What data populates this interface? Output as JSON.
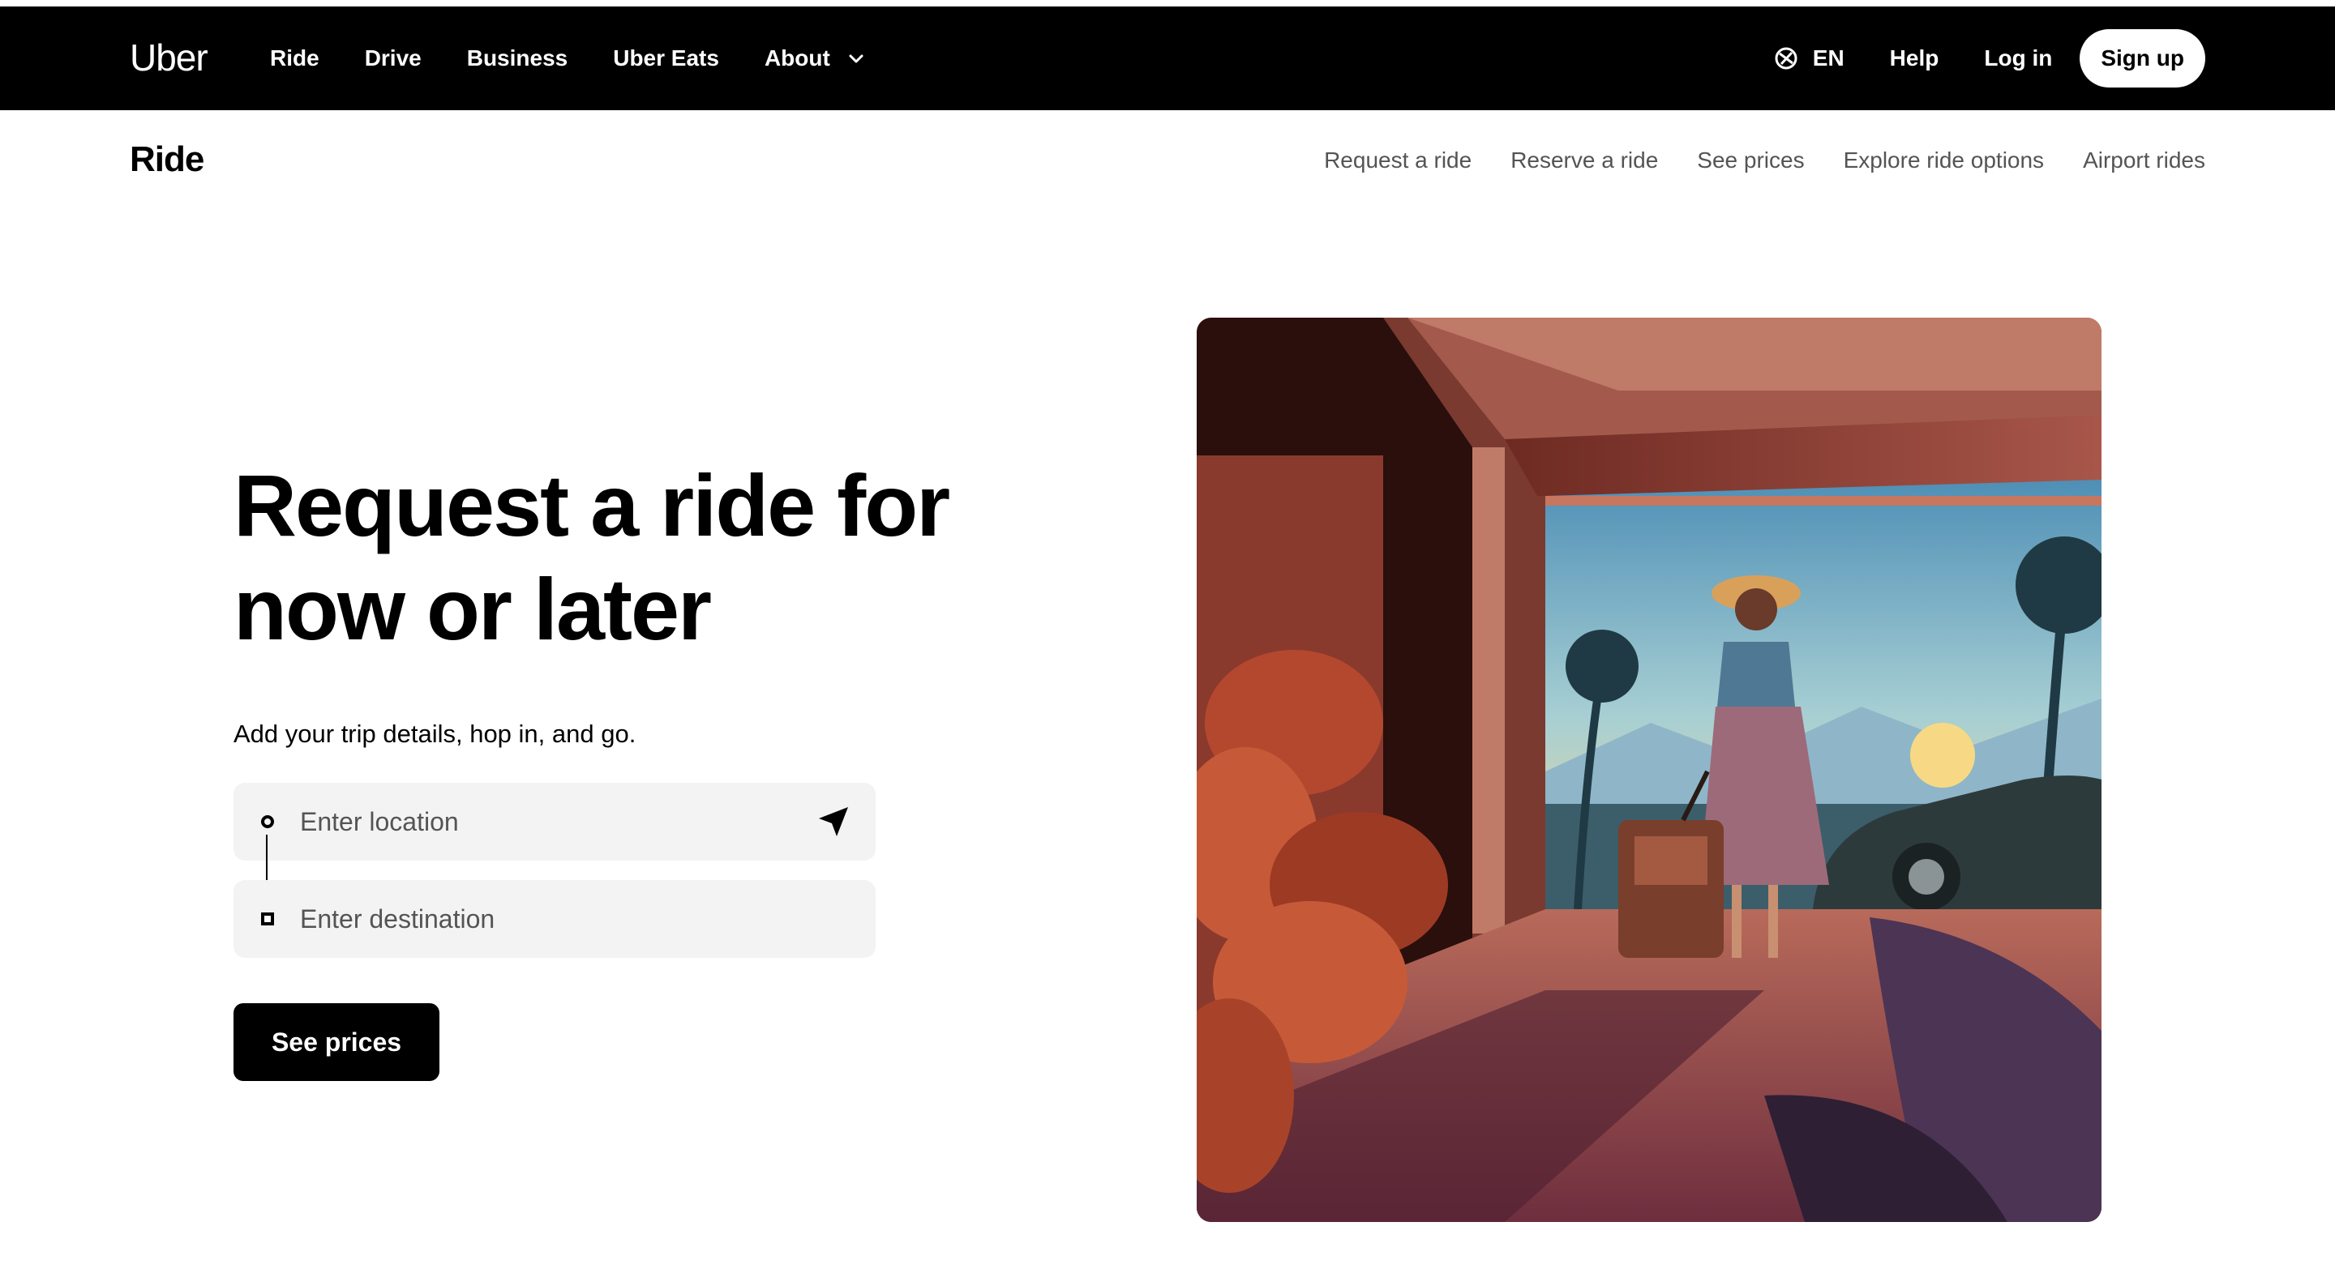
{
  "topbar": {
    "logo": "Uber",
    "nav": [
      "Ride",
      "Drive",
      "Business",
      "Uber Eats",
      "About"
    ],
    "language": "EN",
    "help": "Help",
    "login": "Log in",
    "signup": "Sign up"
  },
  "subnav": {
    "title": "Ride",
    "links": [
      "Request a ride",
      "Reserve a ride",
      "See prices",
      "Explore ride options",
      "Airport rides"
    ]
  },
  "hero": {
    "title_line1": "Request a ride for",
    "title_line2": "now or later",
    "subtitle": "Add your trip details, hop in, and go.",
    "location_placeholder": "Enter location",
    "destination_placeholder": "Enter destination",
    "cta": "See prices"
  },
  "icons": {
    "language": "globe-icon",
    "about_menu": "chevron-down-icon",
    "current_location": "navigation-arrow-icon",
    "pickup": "pickup-dot-icon",
    "dropoff": "dropoff-square-icon"
  },
  "colors": {
    "topbar_bg": "#000000",
    "field_bg": "#f3f3f3",
    "muted_text": "#545454"
  }
}
